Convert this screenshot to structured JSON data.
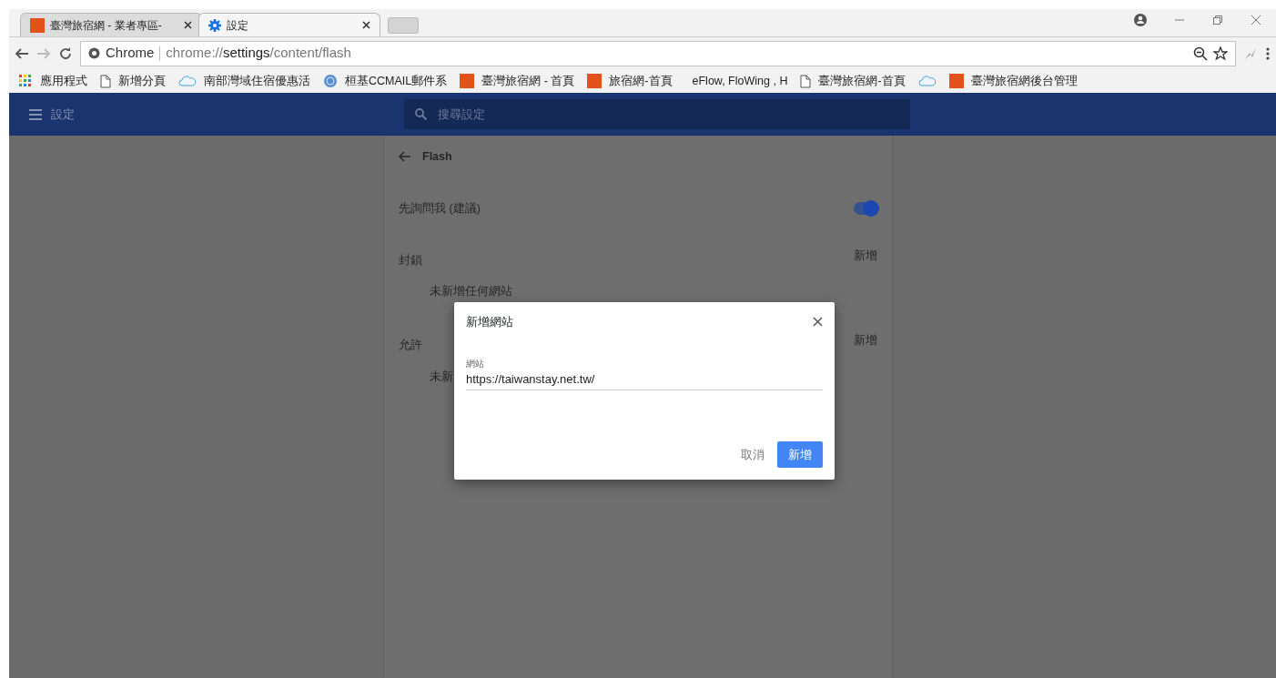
{
  "browser": {
    "tabs": [
      {
        "title": "臺灣旅宿網 - 業者專區-",
        "kind": "lv",
        "selected": false
      },
      {
        "title": "設定",
        "kind": "gear",
        "selected": true
      }
    ],
    "omnibox": {
      "site_label": "Chrome",
      "url_scheme": "chrome://",
      "url_host": "settings",
      "url_path": "/content/flash"
    },
    "bookmarks": [
      {
        "label": "應用程式",
        "kind": "apps"
      },
      {
        "label": "新增分頁",
        "kind": "page"
      },
      {
        "label": "南部灣域住宿優惠活",
        "kind": "cloud"
      },
      {
        "label": "桓基CCMAIL郵件系",
        "kind": "globe"
      },
      {
        "label": "臺灣旅宿網 - 首頁",
        "kind": "lv"
      },
      {
        "label": "旅宿網-首頁",
        "kind": "lv"
      },
      {
        "label": "eFlow, FloWing , H",
        "kind": "blank"
      },
      {
        "label": "臺灣旅宿網-首頁",
        "kind": "page"
      },
      {
        "kind": "cloud"
      },
      {
        "label": "臺灣旅宿網後台管理",
        "kind": "lv"
      }
    ]
  },
  "settings": {
    "title": "設定",
    "search": {
      "placeholder": "搜尋設定"
    },
    "page_title": "Flash",
    "ask_first": {
      "label": "先詢問我 (建議)",
      "on": true
    },
    "sections": [
      {
        "title": "封鎖",
        "add": "新增",
        "empty": "未新增任何網站"
      },
      {
        "title": "允許",
        "add": "新增",
        "empty": "未新"
      }
    ]
  },
  "dialog": {
    "title": "新增網站",
    "field_label": "網站",
    "value": "https://taiwanstay.net.tw/",
    "buttons": [
      {
        "label": "取消",
        "kind": "text"
      },
      {
        "label": "新增",
        "kind": "primary"
      }
    ]
  }
}
